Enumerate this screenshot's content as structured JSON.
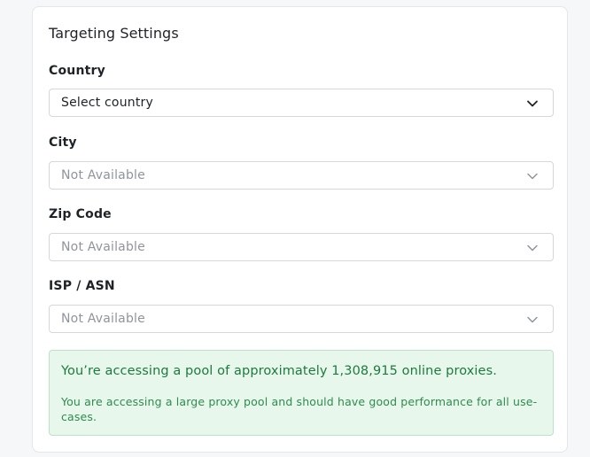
{
  "targeting": {
    "title": "Targeting Settings",
    "fields": [
      {
        "label": "Country",
        "value": "Select country",
        "disabled": false
      },
      {
        "label": "City",
        "value": "Not Available",
        "disabled": true
      },
      {
        "label": "Zip Code",
        "value": "Not Available",
        "disabled": true
      },
      {
        "label": "ISP / ASN",
        "value": "Not Available",
        "disabled": true
      }
    ],
    "notice": {
      "headline": "You’re accessing a pool of approximately 1,308,915 online proxies.",
      "body": "You are accessing a large proxy pool and should have good performance for all use-cases."
    }
  },
  "colors": {
    "notice_bg": "#e8f7ec",
    "notice_text": "#1d7a3e",
    "disabled_text": "#8f959c"
  },
  "icons": {
    "dropdown": "chevron-down-icon"
  }
}
